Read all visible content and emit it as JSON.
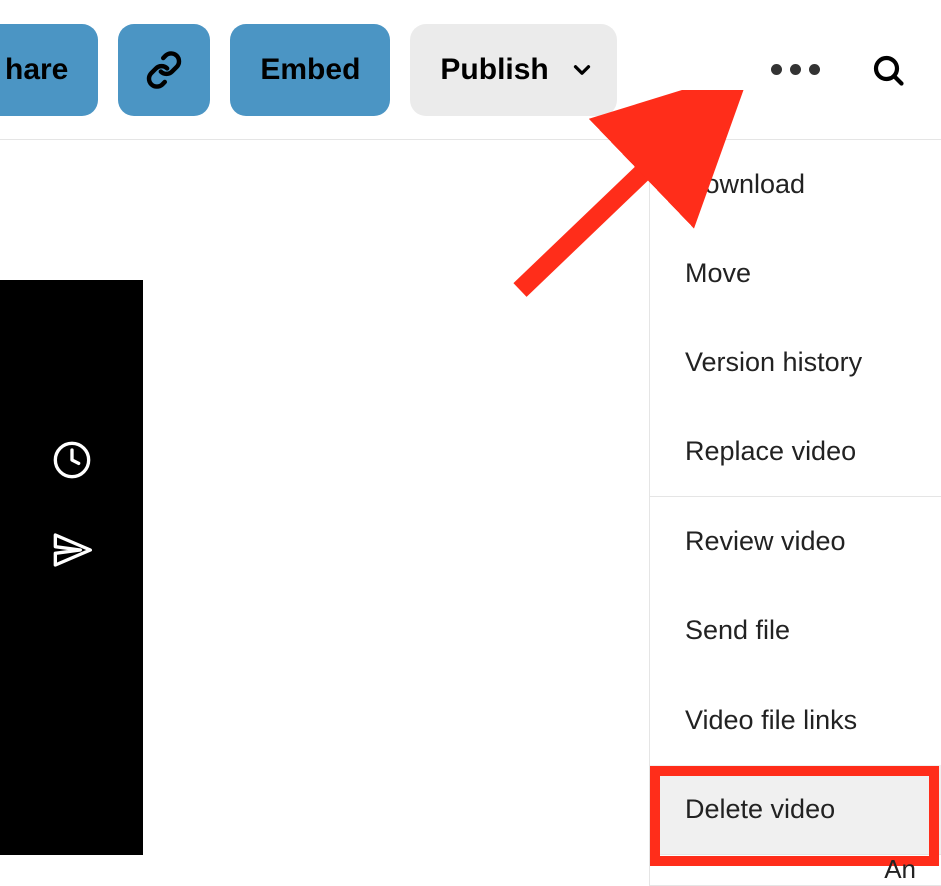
{
  "toolbar": {
    "share_label": "hare",
    "embed_label": "Embed",
    "publish_label": "Publish"
  },
  "menu": {
    "items": [
      "Download",
      "Move",
      "Version history",
      "Replace video",
      "Review video",
      "Send file",
      "Video file links",
      "Delete video"
    ]
  },
  "footer_partial": "An"
}
